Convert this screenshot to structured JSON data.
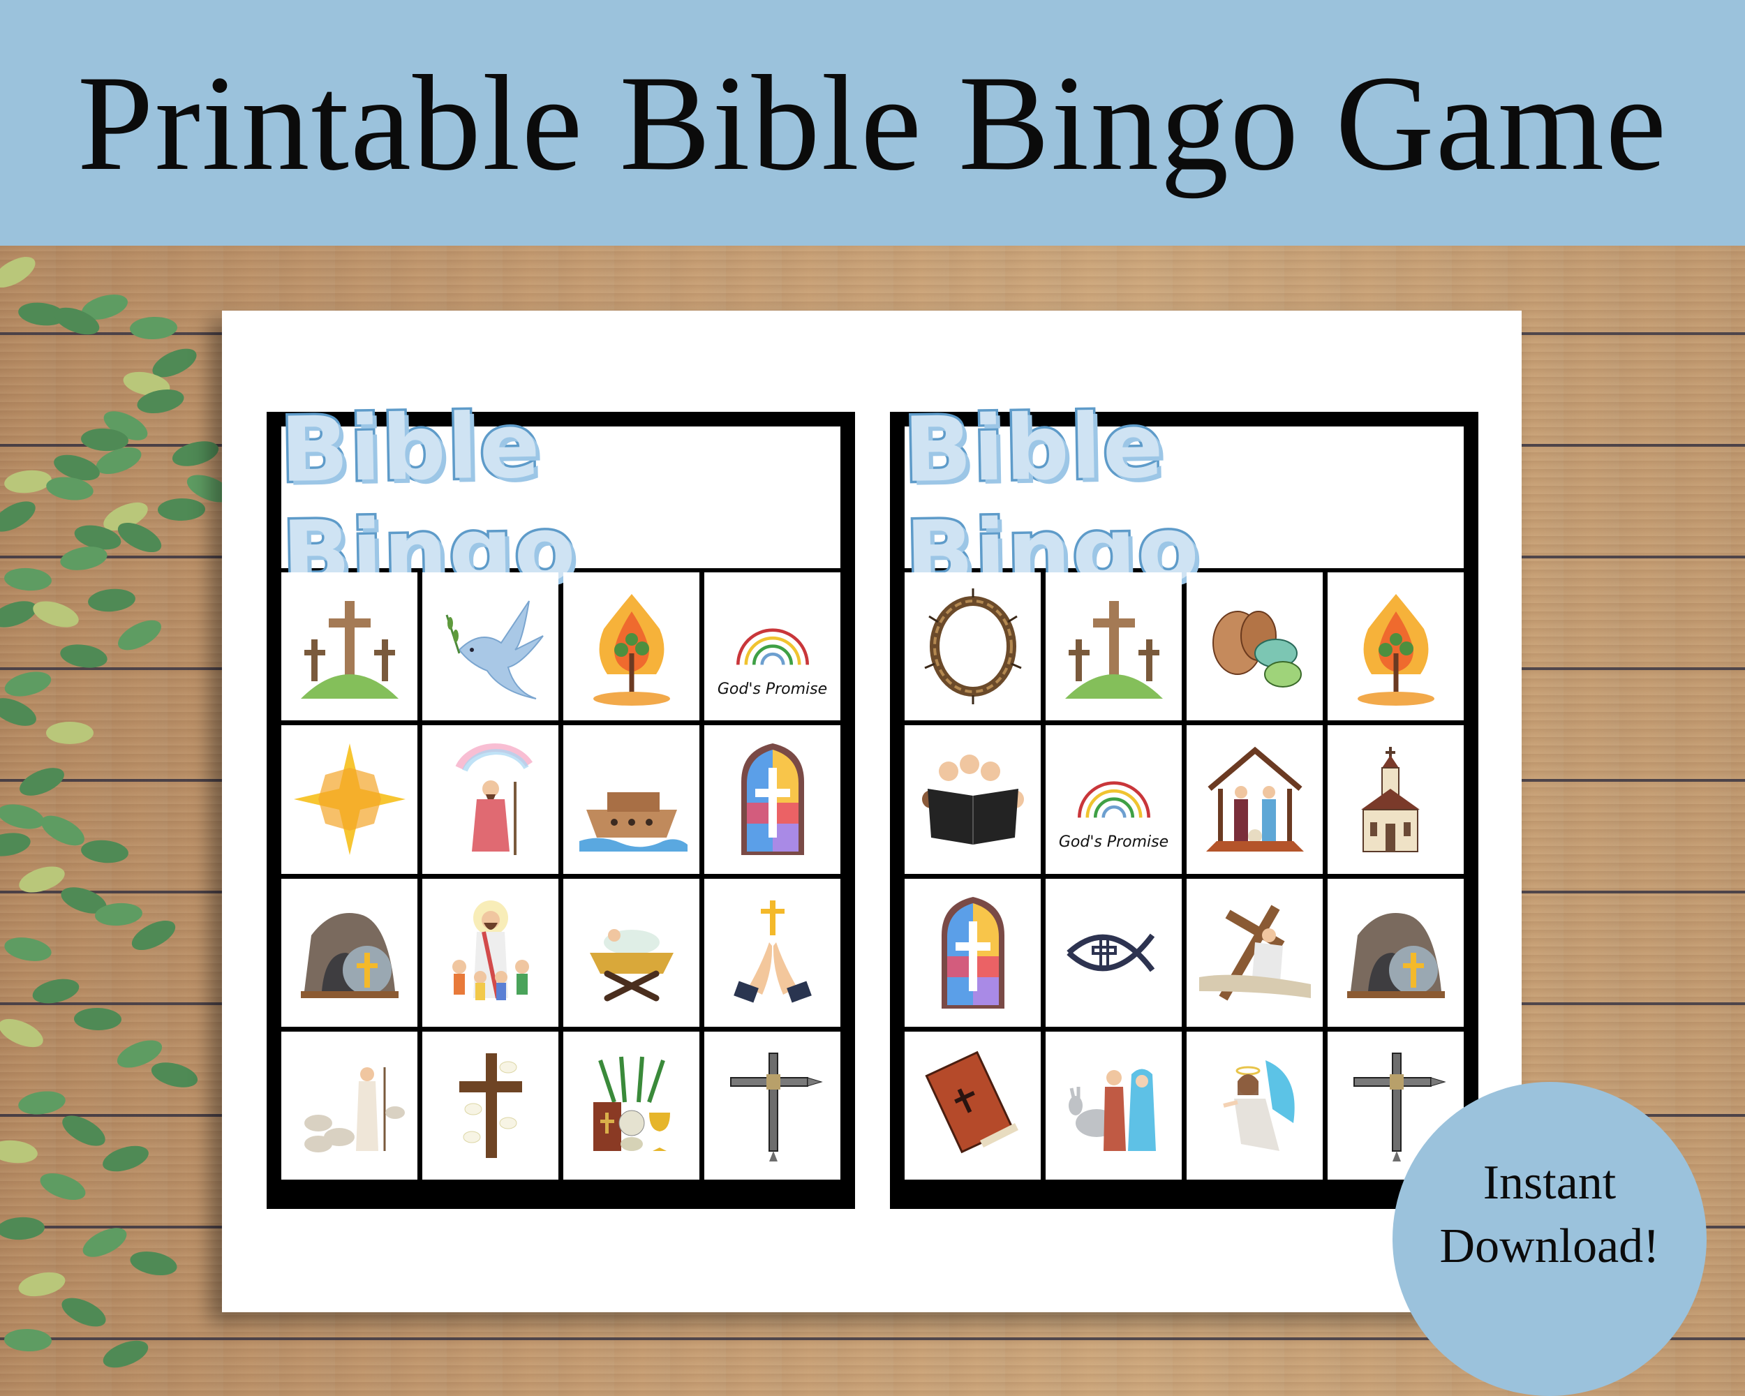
{
  "banner": {
    "title": "Printable Bible Bingo Game",
    "background_color": "#9bc2dc"
  },
  "boards": [
    {
      "title": "Bible Bingo",
      "cells": [
        {
          "icon": "three-crosses-on-hill-icon",
          "label": ""
        },
        {
          "icon": "dove-with-olive-branch-icon",
          "label": ""
        },
        {
          "icon": "burning-bush-icon",
          "label": ""
        },
        {
          "icon": "rainbow-icon",
          "label": "God's Promise"
        },
        {
          "icon": "star-of-bethlehem-icon",
          "label": ""
        },
        {
          "icon": "noah-with-rainbow-icon",
          "label": ""
        },
        {
          "icon": "noahs-ark-icon",
          "label": ""
        },
        {
          "icon": "stained-glass-cross-window-icon",
          "label": ""
        },
        {
          "icon": "empty-tomb-icon",
          "label": ""
        },
        {
          "icon": "jesus-with-children-icon",
          "label": ""
        },
        {
          "icon": "baby-in-manger-icon",
          "label": ""
        },
        {
          "icon": "praying-hands-cross-icon",
          "label": ""
        },
        {
          "icon": "shepherd-with-sheep-icon",
          "label": ""
        },
        {
          "icon": "cross-with-lilies-icon",
          "label": ""
        },
        {
          "icon": "communion-bible-chalice-icon",
          "label": ""
        },
        {
          "icon": "nail-cross-icon",
          "label": ""
        }
      ]
    },
    {
      "title": "Bible Bingo",
      "cells": [
        {
          "icon": "crown-of-thorns-icon",
          "label": ""
        },
        {
          "icon": "three-crosses-on-hill-icon",
          "label": ""
        },
        {
          "icon": "loaves-and-fishes-icon",
          "label": ""
        },
        {
          "icon": "burning-bush-icon",
          "label": ""
        },
        {
          "icon": "children-reading-bible-icon",
          "label": ""
        },
        {
          "icon": "rainbow-icon",
          "label": "God's Promise"
        },
        {
          "icon": "nativity-stable-icon",
          "label": ""
        },
        {
          "icon": "church-icon",
          "label": ""
        },
        {
          "icon": "stained-glass-cross-window-icon",
          "label": ""
        },
        {
          "icon": "ichthys-fish-cross-icon",
          "label": ""
        },
        {
          "icon": "jesus-carrying-cross-icon",
          "label": ""
        },
        {
          "icon": "empty-tomb-icon",
          "label": ""
        },
        {
          "icon": "bible-book-icon",
          "label": ""
        },
        {
          "icon": "mary-joseph-donkey-icon",
          "label": ""
        },
        {
          "icon": "angel-icon",
          "label": ""
        },
        {
          "icon": "nail-cross-icon",
          "label": ""
        }
      ]
    }
  ],
  "badge": {
    "line1": "Instant",
    "line2": "Download!",
    "color": "#9bc2dc"
  }
}
